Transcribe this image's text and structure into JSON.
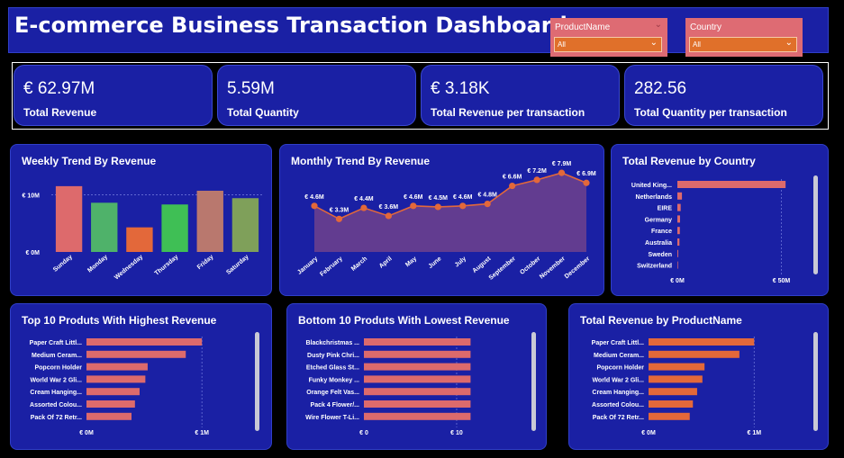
{
  "header": {
    "title": "E-commerce Business Transaction Dashboard",
    "slicers": [
      {
        "label": "ProductName",
        "value": "All"
      },
      {
        "label": "Country",
        "value": "All"
      }
    ]
  },
  "kpis": [
    {
      "value": "€ 62.97M",
      "label": "Total Revenue"
    },
    {
      "value": "5.59M",
      "label": "Total Quantity"
    },
    {
      "value": "€ 3.18K",
      "label": "Total Revenue per transaction"
    },
    {
      "value": "282.56",
      "label": "Total Quantity per transaction"
    }
  ],
  "colors": {
    "background": "#000000",
    "panel": "#1a20a4",
    "bar_red": "#dd6a6c",
    "bar_orange": "#e3683a",
    "line": "#e3683a",
    "area": "#6a3f8e"
  },
  "chart_data": [
    {
      "type": "bar",
      "title": "Weekly Trend By Revenue",
      "categories": [
        "Sunday",
        "Monday",
        "Wednesday",
        "Thursday",
        "Friday",
        "Saturday"
      ],
      "values": [
        11.5,
        8.6,
        4.3,
        8.3,
        10.7,
        9.4
      ],
      "colors": [
        "#dd6a6c",
        "#4fb26a",
        "#e3683a",
        "#3fbf55",
        "#b9786e",
        "#7fa05a"
      ],
      "yticks": [
        "€ 0M",
        "€ 10M"
      ],
      "ylim": [
        0,
        14
      ]
    },
    {
      "type": "area",
      "title": "Monthly Trend By Revenue",
      "categories": [
        "January",
        "February",
        "March",
        "April",
        "May",
        "June",
        "July",
        "August",
        "September",
        "October",
        "November",
        "December"
      ],
      "values": [
        4.6,
        3.3,
        4.4,
        3.6,
        4.6,
        4.5,
        4.6,
        4.8,
        6.6,
        7.2,
        7.9,
        6.9
      ],
      "labels": [
        "€ 4.6M",
        "€ 3.3M",
        "€ 4.4M",
        "€ 3.6M",
        "€ 4.6M",
        "€ 4.5M",
        "€ 4.6M",
        "€ 4.8M",
        "€ 6.6M",
        "€ 7.2M",
        "€ 7.9M",
        "€ 6.9M"
      ],
      "ylim": [
        0,
        8
      ]
    },
    {
      "type": "bar",
      "orientation": "horizontal",
      "title": "Total Revenue by Country",
      "categories": [
        "United King...",
        "Netherlands",
        "EIRE",
        "Germany",
        "France",
        "Australia",
        "Sweden",
        "Switzerland"
      ],
      "values": [
        52,
        2.2,
        1.6,
        1.3,
        1.2,
        1.0,
        0.4,
        0.3
      ],
      "xticks": [
        "€ 0M",
        "€ 50M"
      ],
      "xlim": [
        0,
        58
      ]
    },
    {
      "type": "bar",
      "orientation": "horizontal",
      "title": "Top 10 Produts With Highest Revenue",
      "categories": [
        "Paper Craft Littl...",
        "Medium Ceram...",
        "Popcorn Holder",
        "World War 2 Gli...",
        "Cream Hanging...",
        "Assorted Colou...",
        "Pack Of 72 Retr..."
      ],
      "values": [
        1.0,
        0.86,
        0.53,
        0.51,
        0.46,
        0.42,
        0.39
      ],
      "xticks": [
        "€ 0M",
        "€ 1M"
      ],
      "xlim": [
        0,
        1.1
      ]
    },
    {
      "type": "bar",
      "orientation": "horizontal",
      "title": "Bottom 10 Produts With Lowest Revenue",
      "categories": [
        "Blackchristmas ...",
        "Dusty Pink Chri...",
        "Etched Glass St...",
        "Funky Monkey ...",
        "Orange Felt Vas...",
        "Pack 4 Flower/...",
        "Wire Flower T-Li..."
      ],
      "values": [
        11.5,
        11.5,
        11.5,
        11.5,
        11.5,
        11.5,
        11.5
      ],
      "xticks": [
        "€ 0",
        "€ 10"
      ],
      "xlim": [
        0,
        13.5
      ]
    },
    {
      "type": "bar",
      "orientation": "horizontal",
      "title": "Total Revenue by ProductName",
      "categories": [
        "Paper Craft Littl...",
        "Medium Ceram...",
        "Popcorn Holder",
        "World War 2 Gli...",
        "Cream Hanging...",
        "Assorted Colou...",
        "Pack Of 72 Retr..."
      ],
      "values": [
        1.0,
        0.86,
        0.53,
        0.51,
        0.46,
        0.42,
        0.39
      ],
      "xticks": [
        "€ 0M",
        "€ 1M"
      ],
      "xlim": [
        0,
        1.1
      ]
    }
  ]
}
